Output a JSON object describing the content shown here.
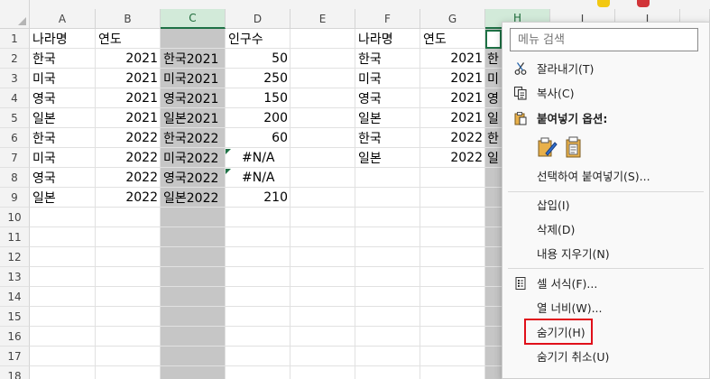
{
  "columns": [
    "A",
    "B",
    "C",
    "D",
    "E",
    "F",
    "G",
    "H",
    "I",
    "J"
  ],
  "rows": [
    "1",
    "2",
    "3",
    "4",
    "5",
    "6",
    "7",
    "8",
    "9",
    "10",
    "11",
    "12",
    "13",
    "14",
    "15",
    "16",
    "17",
    "18"
  ],
  "cells": {
    "A": [
      "나라명",
      "한국",
      "미국",
      "영국",
      "일본",
      "한국",
      "미국",
      "영국",
      "일본"
    ],
    "B": [
      "연도",
      "2021",
      "2021",
      "2021",
      "2021",
      "2022",
      "2022",
      "2022",
      "2022"
    ],
    "C": [
      "",
      "한국2021",
      "미국2021",
      "영국2021",
      "일본2021",
      "한국2022",
      "미국2022",
      "영국2022",
      "일본2022"
    ],
    "D": [
      "인구수",
      "50",
      "250",
      "150",
      "200",
      "60",
      "#N/A",
      "#N/A",
      "210"
    ],
    "F": [
      "나라명",
      "한국",
      "미국",
      "영국",
      "일본",
      "한국",
      "일본"
    ],
    "G": [
      "연도",
      "2021",
      "2021",
      "2021",
      "2021",
      "2022",
      "2022"
    ],
    "H": [
      "",
      "한",
      "미",
      "영",
      "일",
      "한",
      "일"
    ]
  },
  "menu": {
    "search_placeholder": "메뉴 검색",
    "items": {
      "cut": "잘라내기(T)",
      "copy": "복사(C)",
      "paste_options": "붙여넣기 옵션:",
      "paste_special": "선택하여 붙여넣기(S)...",
      "insert": "삽입(I)",
      "delete": "삭제(D)",
      "clear": "내용 지우기(N)",
      "format_cells": "셀 서식(F)...",
      "column_width": "열 너비(W)...",
      "hide": "숨기기(H)",
      "unhide": "숨기기 취소(U)"
    }
  },
  "colors": {
    "accent": "#1e7145",
    "highlight": "#e0101a",
    "hidden_column": "#c6c6c6"
  }
}
